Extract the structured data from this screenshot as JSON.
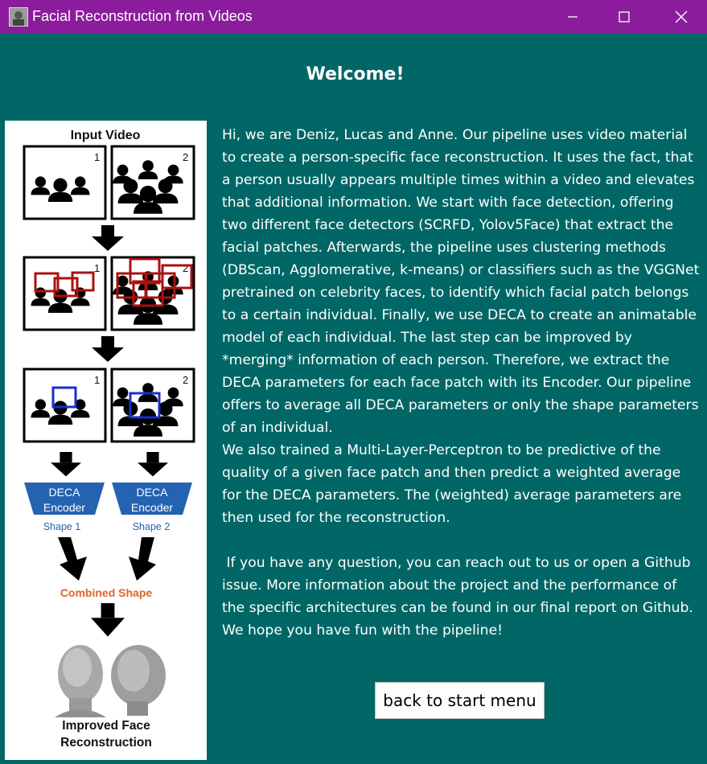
{
  "window": {
    "title": "Facial Reconstruction from Videos"
  },
  "main": {
    "heading": "Welcome!",
    "paragraphs": [
      "Hi, we are Deniz, Lucas and Anne. Our pipeline uses video material to create a person-specific face reconstruction. It uses the fact, that a person usually appears multiple times within a video and elevates that additional information. We start with face detection, offering two different face detectors (SCRFD, Yolov5Face) that extract the facial patches. Afterwards, the pipeline uses clustering methods (DBScan, Agglomerative, k-means) or classifiers such as the VGGNet pretrained on celebrity faces, to identify which facial patch belongs to a certain individual. Finally, we use DECA to create an animatable model of each individual. The last step can be improved by *merging* information of each person. Therefore, we extract the DECA parameters for each face patch with its Encoder. Our pipeline offers to average all DECA parameters or only the shape parameters of an individual.",
      "We also trained a Multi-Layer-Perceptron to be predictive of the quality of a given face patch and then predict a weighted average for the DECA parameters. The (weighted) average parameters are then used for the reconstruction.",
      "",
      " If you have any question, you can reach out to us or open a Github issue. More information about the project and the performance of the specific architectures can be found in our final report on Github. We hope you have fun with the pipeline!"
    ],
    "back_button": "back to start menu"
  },
  "pipeline": {
    "title": "Input Video",
    "frame_numbers": [
      "1",
      "2"
    ],
    "encoder_label_line1": "DECA",
    "encoder_label_line2": "Encoder",
    "shape_labels": [
      "Shape 1",
      "Shape 2"
    ],
    "combined_label": "Combined Shape",
    "result_line1": "Improved Face",
    "result_line2": "Reconstruction",
    "colors": {
      "encoder": "#2463b0",
      "shape_text": "#2463b0",
      "combined_text": "#e0622c",
      "detection_box": "#aa1111",
      "selection_box": "#1a2fc8"
    }
  }
}
